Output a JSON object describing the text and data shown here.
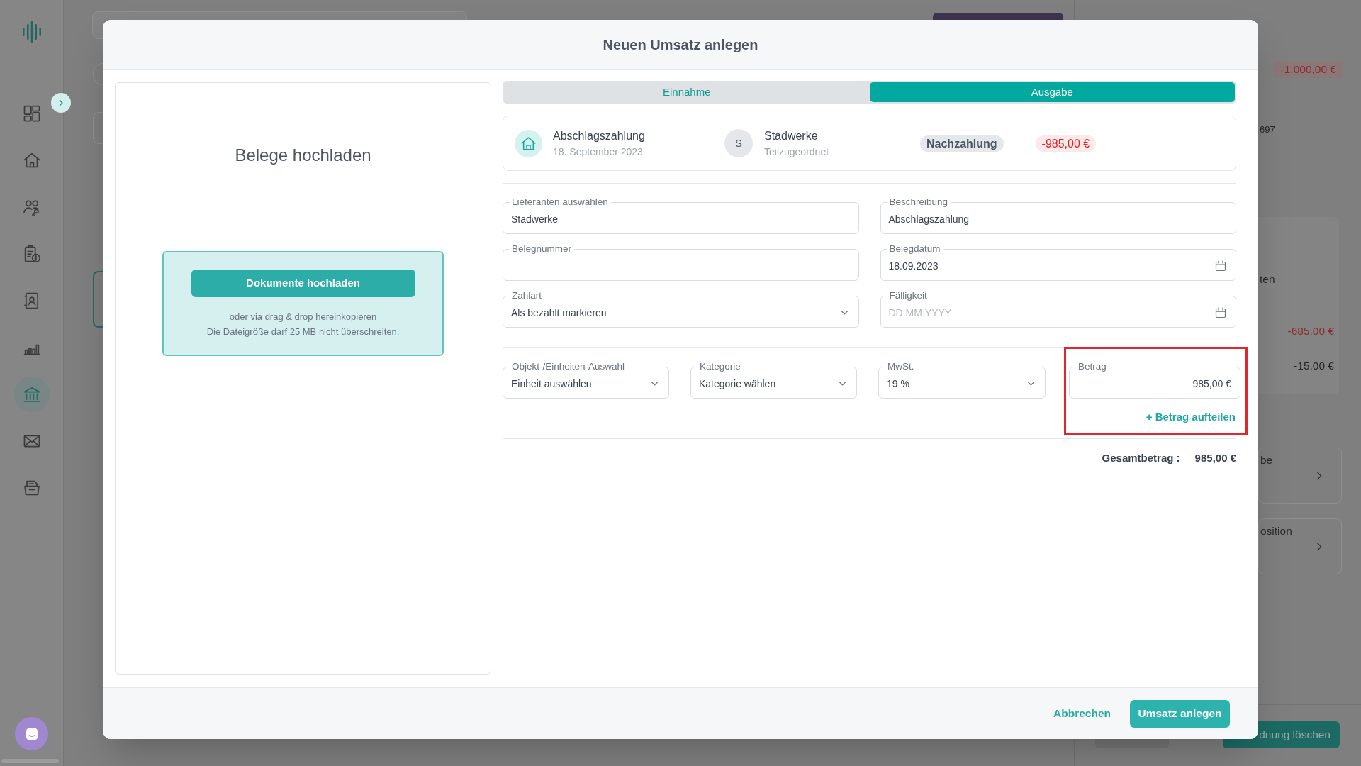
{
  "app": {
    "sidebar": {
      "items": [
        {
          "selected": false
        },
        {
          "selected": false
        },
        {
          "selected": false
        },
        {
          "selected": false
        },
        {
          "selected": false
        },
        {
          "selected": false
        },
        {
          "selected": true
        },
        {
          "selected": false
        },
        {
          "selected": false
        }
      ]
    },
    "right_panel": {
      "amount": "-1.000,00 €",
      "reference": "697",
      "summary": {
        "label": "ten",
        "rows": [
          {
            "value": "-685,00 €",
            "highlighted": true
          },
          {
            "value": "-15,00 €",
            "highlighted": false
          }
        ]
      },
      "cards": [
        {
          "title": "be"
        },
        {
          "title": "osition"
        }
      ],
      "buttons": [
        {
          "kind": "secondary"
        },
        {
          "kind": "primary",
          "label": "dnung löschen"
        }
      ]
    }
  },
  "modal": {
    "title": "Neuen Umsatz anlegen",
    "upload": {
      "title": "Belege hochladen",
      "button": "Dokumente hochladen",
      "hints": [
        "oder via drag & drop hereinkopieren",
        "Die Dateigröße darf 25 MB nicht überschreiten."
      ]
    },
    "tabs": [
      {
        "label": "Einnahme",
        "selected": false
      },
      {
        "label": "Ausgabe",
        "selected": true
      }
    ],
    "transaction": {
      "title": "Abschlagszahlung",
      "date": "18. September 2023",
      "contact_initial": "S",
      "contact": "Stadwerke",
      "assignment": "Teilzugeordnet",
      "tag": "Nachzahlung",
      "amount": "-985,00 €"
    },
    "fields": [
      {
        "kind": "text",
        "label": "Lieferanten auswählen",
        "value": "Stadwerke"
      },
      {
        "kind": "text",
        "label": "Beschreibung",
        "value": "Abschlagszahlung"
      },
      {
        "kind": "text",
        "label": "Belegnummer"
      },
      {
        "kind": "date",
        "label": "Belegdatum",
        "value": "18.09.2023"
      },
      {
        "kind": "select",
        "label": "Zahlart",
        "value": "Als bezahlt markieren"
      },
      {
        "kind": "date",
        "label": "Fälligkeit",
        "placeholder": "DD.MM.YYYY"
      }
    ],
    "allocation": {
      "fields": [
        {
          "kind": "select",
          "label": "Objekt-/Einheiten-Auswahl",
          "value": "Einheit auswählen"
        },
        {
          "kind": "select",
          "label": "Kategorie",
          "value": "Kategorie wählen"
        },
        {
          "kind": "select",
          "label": "MwSt.",
          "value": "19 %"
        },
        {
          "kind": "amount",
          "label": "Betrag",
          "value": "985,00 €"
        }
      ],
      "split_link": "+ Betrag aufteilen",
      "highlighted": true
    },
    "total": {
      "label": "Gesamtbetrag :",
      "value": "985,00 €"
    },
    "buttons": [
      {
        "kind": "link",
        "label": "Abbrechen"
      },
      {
        "kind": "primary",
        "label": "Umsatz anlegen"
      }
    ]
  }
}
